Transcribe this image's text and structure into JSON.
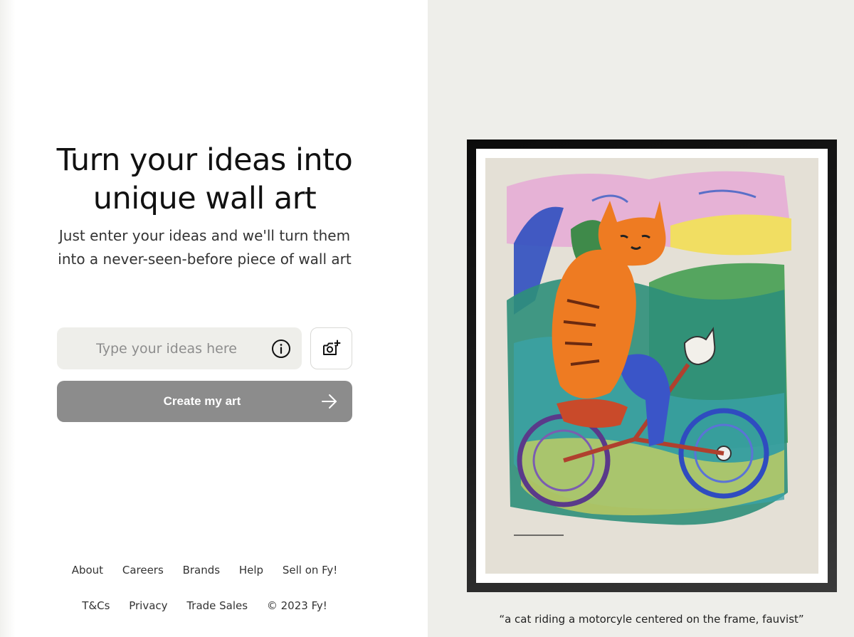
{
  "hero": {
    "headline_line1": "Turn your ideas into",
    "headline_line2": "unique wall art",
    "subhead_line1": "Just enter your ideas and we'll turn them",
    "subhead_line2": "into a never-seen-before piece of wall art"
  },
  "prompt_input": {
    "placeholder": "Type your ideas here",
    "value": "",
    "info_icon": "info-circle-icon",
    "upload_icon": "camera-plus-icon"
  },
  "create_button": {
    "label": "Create my art",
    "icon": "arrow-right-icon"
  },
  "footer": {
    "links_row1": [
      "About",
      "Careers",
      "Brands",
      "Help",
      "Sell on Fy!"
    ],
    "links_row2": [
      "T&Cs",
      "Privacy",
      "Trade Sales"
    ],
    "copyright": "© 2023 Fy!"
  },
  "preview": {
    "caption": "“a cat riding a motorcyle centered on the frame, fauvist”",
    "frame_color": "#111111"
  },
  "colors": {
    "right_panel_bg": "#eeeeea",
    "input_bg": "#eeeeea",
    "button_bg": "#8c8c8c",
    "button_text": "#ffffff"
  }
}
